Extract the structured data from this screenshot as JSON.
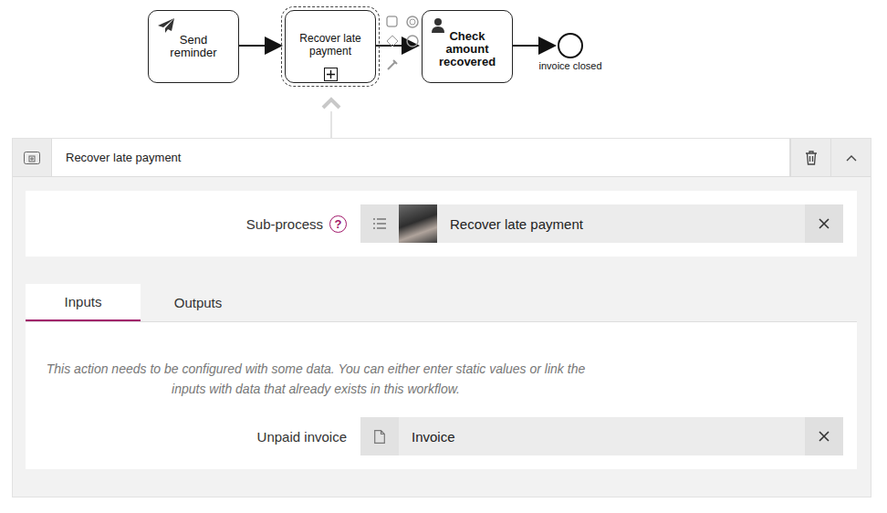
{
  "diagram": {
    "nodes": [
      {
        "label": "Send reminder",
        "kind": "send-task",
        "selected": false
      },
      {
        "label": "Recover late payment",
        "kind": "subprocess",
        "selected": true
      },
      {
        "label": "Check amount recovered",
        "kind": "user-task",
        "selected": false
      }
    ],
    "end_event": {
      "label": "invoice closed"
    }
  },
  "panel": {
    "title": "Recover late payment",
    "subprocess": {
      "label": "Sub-process",
      "help": "?",
      "value": "Recover late payment"
    },
    "tabs": [
      {
        "label": "Inputs",
        "selected": true
      },
      {
        "label": "Outputs",
        "selected": false
      }
    ],
    "help_text": "This action needs to be configured with some data. You can either enter static values or link the inputs with data that already exists in this workflow.",
    "inputs": [
      {
        "label": "Unpaid invoice",
        "value": "Invoice"
      }
    ]
  }
}
